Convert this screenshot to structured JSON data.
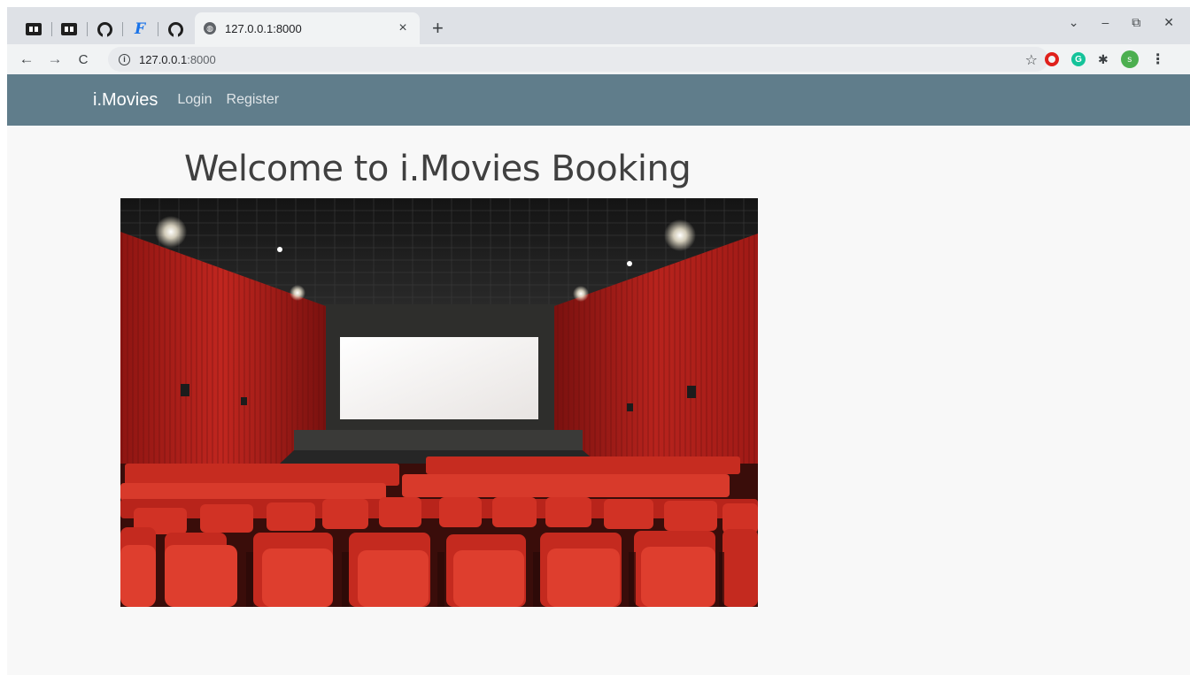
{
  "browser": {
    "tab_title": "127.0.0.1:8000",
    "tab_close": "×",
    "new_tab": "+",
    "url_host": "127.0.0.1",
    "url_port": ":8000",
    "win_dropdown": "⌄",
    "win_minimize": "–",
    "win_restore": "⧉",
    "win_close": "✕",
    "avatar_letter": "s",
    "ext_g_letter": "G"
  },
  "site": {
    "brand": "i.Movies",
    "nav": [
      {
        "label": "Login"
      },
      {
        "label": "Register"
      }
    ],
    "heading": "Welcome to i.Movies Booking"
  },
  "colors": {
    "navbar": "#607d8b",
    "page_bg": "#f8f8f8",
    "heading": "#404040",
    "curtain": "#b3201e",
    "seat": "#d42a1e"
  }
}
